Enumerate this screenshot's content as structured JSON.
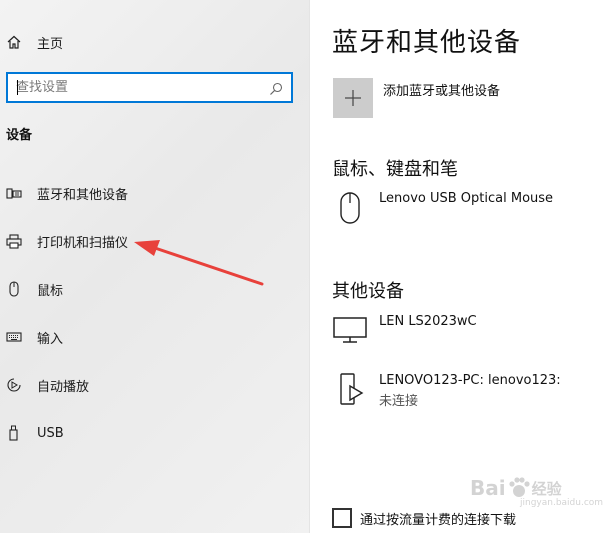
{
  "sidebar": {
    "home_label": "主页",
    "search": {
      "placeholder": "查找设置",
      "value": ""
    },
    "section_title": "设备",
    "items": [
      {
        "label": "蓝牙和其他设备",
        "icon": "bluetooth-devices-icon"
      },
      {
        "label": "打印机和扫描仪",
        "icon": "printer-icon"
      },
      {
        "label": "鼠标",
        "icon": "mouse-icon"
      },
      {
        "label": "输入",
        "icon": "keyboard-icon"
      },
      {
        "label": "自动播放",
        "icon": "autoplay-icon"
      },
      {
        "label": "USB",
        "icon": "usb-icon"
      }
    ],
    "annotation_arrow_color": "#e8413b"
  },
  "main": {
    "title": "蓝牙和其他设备",
    "add_device_label": "添加蓝牙或其他设备",
    "mouse_section": {
      "title": "鼠标、键盘和笔",
      "devices": [
        {
          "name": "Lenovo USB Optical Mouse",
          "icon": "mouse-icon"
        }
      ]
    },
    "other_section": {
      "title": "其他设备",
      "devices": [
        {
          "name": "LEN LS2023wC",
          "icon": "monitor-icon"
        },
        {
          "name": "LENOVO123-PC: lenovo123:",
          "status": "未连接",
          "icon": "media-device-icon"
        }
      ]
    },
    "metered_label": "通过按流量计费的连接下载",
    "metered_checked": false
  },
  "watermark": {
    "text": "Bai",
    "text2": "经验",
    "sub": "jingyan.baidu.com"
  },
  "colors": {
    "accent": "#0078d7",
    "tile": "#cccccc"
  }
}
